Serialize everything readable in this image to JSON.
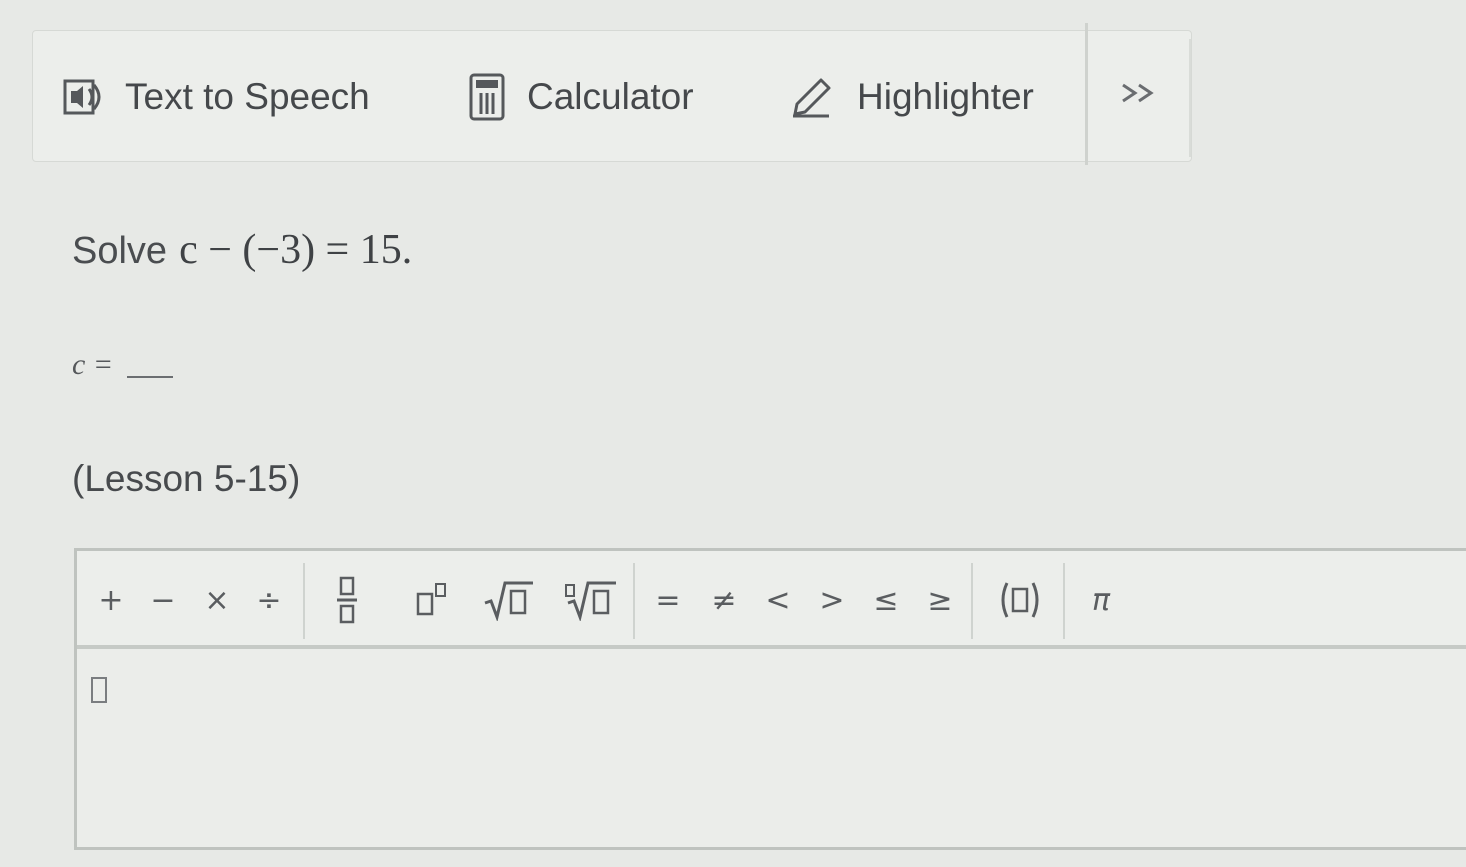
{
  "toolbar": {
    "text_to_speech": "Text to Speech",
    "calculator": "Calculator",
    "highlighter": "Highlighter",
    "more": "»",
    "icons": [
      "speaker-icon",
      "calculator-icon",
      "highlighter-pen-icon",
      "double-chevron-right-icon"
    ]
  },
  "question": {
    "prompt": "Solve",
    "equation": "c − (−3) = 15.",
    "answer_label": "c =",
    "lesson": "(Lesson 5-15)"
  },
  "editor": {
    "keys": {
      "plus": "+",
      "minus": "−",
      "times": "×",
      "divide": "÷",
      "equals": "=",
      "not_equal": "≠",
      "less_than": "<",
      "greater_than": ">",
      "less_equal": "≤",
      "greater_equal": "≥",
      "pi": "π"
    },
    "template_icons": [
      "fraction-icon",
      "exponent-icon",
      "square-root-icon",
      "nth-root-icon",
      "parentheses-icon"
    ]
  },
  "colors": {
    "background": "#e7e9e6",
    "text": "#45484b",
    "border": "#c6cac6"
  }
}
